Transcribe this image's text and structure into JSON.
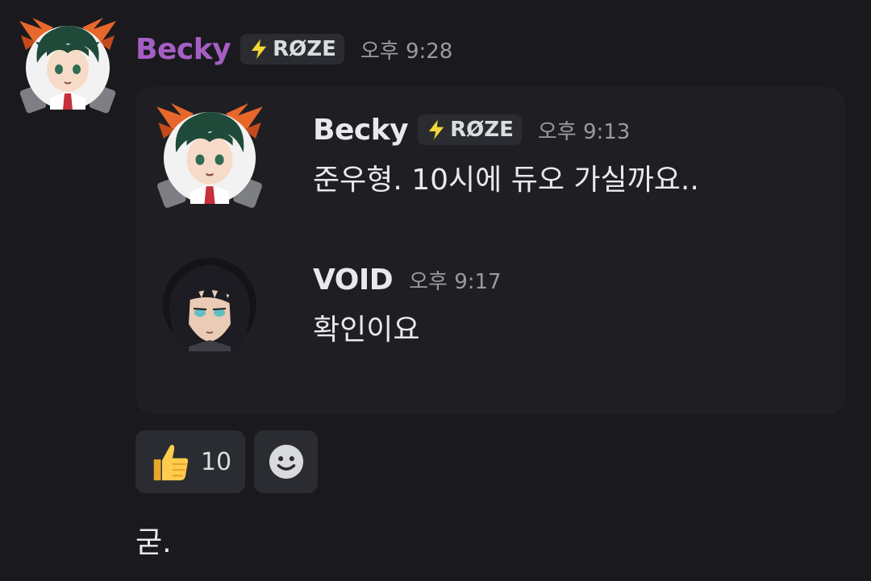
{
  "message": {
    "author": "Becky",
    "tag_icon": "lightning-bolt-icon",
    "tag_label": "RØZE",
    "timestamp": "오후 9:28",
    "author_color": "#a55fc4"
  },
  "embed": {
    "messages": [
      {
        "author": "Becky",
        "tag_label": "RØZE",
        "timestamp": "오후 9:13",
        "text": "준우형. 10시에 듀오 가실까요.."
      },
      {
        "author": "VOID",
        "timestamp": "오후 9:17",
        "text": "확인이요"
      }
    ]
  },
  "reactions": [
    {
      "emoji": "thumbs-up-icon",
      "count": "10"
    },
    {
      "emoji": "add-reaction-smiley-icon"
    }
  ],
  "final_message": "굳."
}
